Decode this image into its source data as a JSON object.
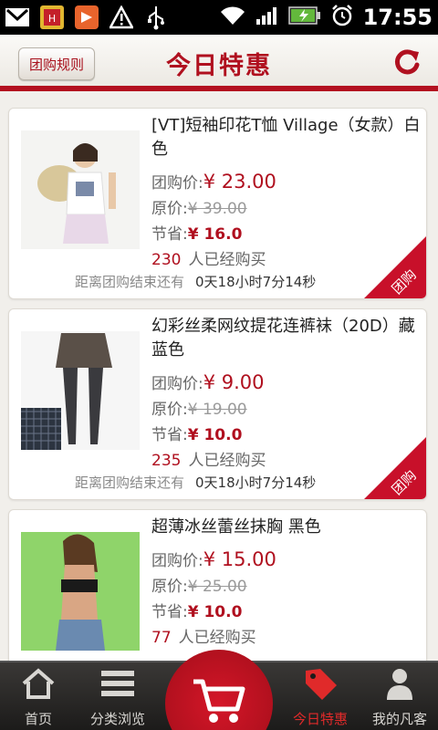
{
  "status_bar": {
    "time": "17:55",
    "left_icons": [
      "gmail-icon",
      "app-icon",
      "media-icon",
      "warning-icon",
      "usb-icon"
    ],
    "right_icons": [
      "wifi-icon",
      "signal-icon",
      "battery-charging-icon",
      "alarm-icon"
    ]
  },
  "header": {
    "rules_button": "团购规则",
    "title": "今日特惠"
  },
  "labels": {
    "group_price": "团购价:",
    "original_price": "原价:",
    "save": "节省:",
    "sold_suffix": "人已经购买",
    "countdown_prefix": "距离团购结束还有",
    "ribbon": "团购"
  },
  "products": [
    {
      "name": "[VT]短袖印花T恤 Village（女款）白色",
      "group_price": "¥ 23.00",
      "original_price": "¥ 39.00",
      "save": "¥ 16.0",
      "sold": "230",
      "countdown": "0天18小时7分14秒"
    },
    {
      "name": "幻彩丝柔网纹提花连裤袜（20D）藏蓝色",
      "group_price": "¥ 9.00",
      "original_price": "¥ 19.00",
      "save": "¥ 10.0",
      "sold": "235",
      "countdown": "0天18小时7分14秒"
    },
    {
      "name": "超薄冰丝蕾丝抹胸 黑色",
      "group_price": "¥ 15.00",
      "original_price": "¥ 25.00",
      "save": "¥ 10.0",
      "sold": "77",
      "countdown": ""
    }
  ],
  "bottom_nav": {
    "home": "首页",
    "categories": "分类浏览",
    "today": "今日特惠",
    "my": "我的凡客"
  },
  "colors": {
    "accent": "#b0101f",
    "active_nav": "#e02a2a"
  }
}
